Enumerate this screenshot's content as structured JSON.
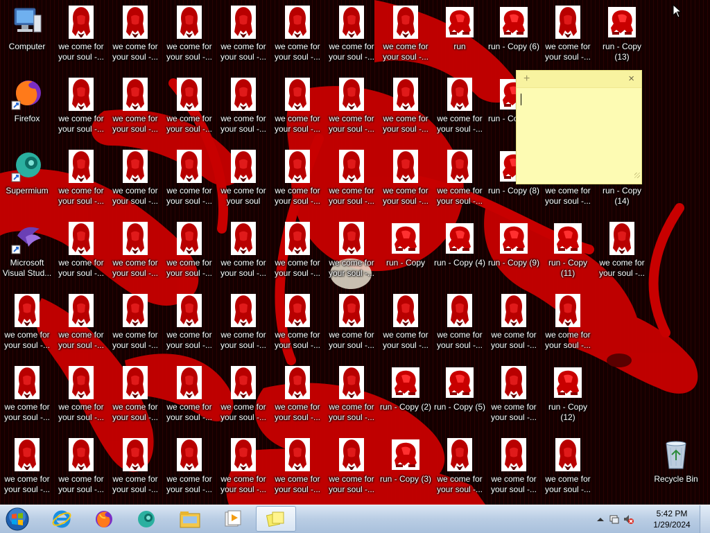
{
  "desktop": {
    "icons": [
      {
        "label": "Computer",
        "type": "computer",
        "col": 0,
        "row": 0
      },
      {
        "label": "Firefox",
        "type": "firefox",
        "col": 0,
        "row": 1
      },
      {
        "label": "Supermium",
        "type": "supermium",
        "col": 0,
        "row": 2
      },
      {
        "label": "Microsoft Visual Stud...",
        "type": "vs",
        "col": 0,
        "row": 3
      },
      {
        "label": "we come for your soul -...",
        "type": "soul",
        "col": 0,
        "row": 4
      },
      {
        "label": "we come for your soul -...",
        "type": "soul",
        "col": 0,
        "row": 5
      },
      {
        "label": "we come for your soul -...",
        "type": "soul",
        "col": 0,
        "row": 6
      },
      {
        "label": "we come for your soul -...",
        "type": "soul",
        "col": 1,
        "row": 0
      },
      {
        "label": "we come for your soul -...",
        "type": "soul",
        "col": 1,
        "row": 1
      },
      {
        "label": "we come for your soul -...",
        "type": "soul",
        "col": 1,
        "row": 2
      },
      {
        "label": "we come for your soul -...",
        "type": "soul",
        "col": 1,
        "row": 3
      },
      {
        "label": "we come for your soul -...",
        "type": "soul",
        "col": 1,
        "row": 4
      },
      {
        "label": "we come for your soul -...",
        "type": "soul",
        "col": 1,
        "row": 5
      },
      {
        "label": "we come for your soul -...",
        "type": "soul",
        "col": 1,
        "row": 6
      },
      {
        "label": "we come for your soul -...",
        "type": "soul",
        "col": 2,
        "row": 0
      },
      {
        "label": "we come for your soul -...",
        "type": "soul",
        "col": 2,
        "row": 1
      },
      {
        "label": "we come for your soul -...",
        "type": "soul",
        "col": 2,
        "row": 2
      },
      {
        "label": "we come for your soul -...",
        "type": "soul",
        "col": 2,
        "row": 3
      },
      {
        "label": "we come for your soul -...",
        "type": "soul",
        "col": 2,
        "row": 4
      },
      {
        "label": "we come for your soul -...",
        "type": "soul",
        "col": 2,
        "row": 5
      },
      {
        "label": "we come for your soul -...",
        "type": "soul",
        "col": 2,
        "row": 6
      },
      {
        "label": "we come for your soul -...",
        "type": "soul",
        "col": 3,
        "row": 0
      },
      {
        "label": "we come for your soul -...",
        "type": "soul",
        "col": 3,
        "row": 1
      },
      {
        "label": "we come for your soul -...",
        "type": "soul",
        "col": 3,
        "row": 2
      },
      {
        "label": "we come for your soul -...",
        "type": "soul",
        "col": 3,
        "row": 3
      },
      {
        "label": "we come for your soul -...",
        "type": "soul",
        "col": 3,
        "row": 4
      },
      {
        "label": "we come for your soul -...",
        "type": "soul",
        "col": 3,
        "row": 5
      },
      {
        "label": "we come for your soul -...",
        "type": "soul",
        "col": 3,
        "row": 6
      },
      {
        "label": "we come for your soul -...",
        "type": "soul",
        "col": 4,
        "row": 0
      },
      {
        "label": "we come for your soul -...",
        "type": "soul",
        "col": 4,
        "row": 1
      },
      {
        "label": "we come for your soul",
        "type": "soul",
        "col": 4,
        "row": 2
      },
      {
        "label": "we come for your soul -...",
        "type": "soul",
        "col": 4,
        "row": 3
      },
      {
        "label": "we come for your soul -...",
        "type": "soul",
        "col": 4,
        "row": 4
      },
      {
        "label": "we come for your soul -...",
        "type": "soul",
        "col": 4,
        "row": 5
      },
      {
        "label": "we come for your soul -...",
        "type": "soul",
        "col": 4,
        "row": 6
      },
      {
        "label": "we come for your soul -...",
        "type": "soul",
        "col": 5,
        "row": 0
      },
      {
        "label": "we come for your soul -...",
        "type": "soul",
        "col": 5,
        "row": 1
      },
      {
        "label": "we come for your soul -...",
        "type": "soul",
        "col": 5,
        "row": 2
      },
      {
        "label": "we come for your soul -...",
        "type": "soul",
        "col": 5,
        "row": 3
      },
      {
        "label": "we come for your soul -...",
        "type": "soul",
        "col": 5,
        "row": 4
      },
      {
        "label": "we come for your soul -...",
        "type": "soul",
        "col": 5,
        "row": 5
      },
      {
        "label": "we come for your soul -...",
        "type": "soul",
        "col": 5,
        "row": 6
      },
      {
        "label": "we come for your soul -...",
        "type": "soul",
        "col": 6,
        "row": 0
      },
      {
        "label": "we come for your soul -...",
        "type": "soul",
        "col": 6,
        "row": 1
      },
      {
        "label": "we come for your soul -...",
        "type": "soul",
        "col": 6,
        "row": 2
      },
      {
        "label": "we come for your soul -...",
        "type": "soul",
        "col": 6,
        "row": 3
      },
      {
        "label": "we come for your soul -...",
        "type": "soul",
        "col": 6,
        "row": 4
      },
      {
        "label": "we come for your soul -...",
        "type": "soul",
        "col": 6,
        "row": 5
      },
      {
        "label": "we come for your soul -...",
        "type": "soul",
        "col": 6,
        "row": 6
      },
      {
        "label": "we come for your soul -...",
        "type": "soul",
        "col": 7,
        "row": 0
      },
      {
        "label": "we come for your soul -...",
        "type": "soul",
        "col": 7,
        "row": 1
      },
      {
        "label": "we come for your soul -...",
        "type": "soul",
        "col": 7,
        "row": 2
      },
      {
        "label": "run - Copy",
        "type": "run",
        "col": 7,
        "row": 3
      },
      {
        "label": "we come for your soul -...",
        "type": "soul",
        "col": 7,
        "row": 4
      },
      {
        "label": "run - Copy (2)",
        "type": "run",
        "col": 7,
        "row": 5
      },
      {
        "label": "run - Copy (3)",
        "type": "run",
        "col": 7,
        "row": 6
      },
      {
        "label": "run",
        "type": "run",
        "col": 8,
        "row": 0
      },
      {
        "label": "we come for your soul -...",
        "type": "soul",
        "col": 8,
        "row": 1
      },
      {
        "label": "we come for your soul -...",
        "type": "soul",
        "col": 8,
        "row": 2
      },
      {
        "label": "run - Copy (4)",
        "type": "run",
        "col": 8,
        "row": 3
      },
      {
        "label": "we come for your soul -...",
        "type": "soul",
        "col": 8,
        "row": 4
      },
      {
        "label": "run - Copy (5)",
        "type": "run",
        "col": 8,
        "row": 5
      },
      {
        "label": "we come for your soul -...",
        "type": "soul",
        "col": 8,
        "row": 6
      },
      {
        "label": "run - Copy (6)",
        "type": "run",
        "col": 9,
        "row": 0
      },
      {
        "label": "run - Copy (7)",
        "type": "run",
        "col": 9,
        "row": 1
      },
      {
        "label": "run - Copy (8)",
        "type": "run",
        "col": 9,
        "row": 2
      },
      {
        "label": "run - Copy (9)",
        "type": "run",
        "col": 9,
        "row": 3
      },
      {
        "label": "we come for your soul -...",
        "type": "soul",
        "col": 9,
        "row": 4
      },
      {
        "label": "we come for your soul -...",
        "type": "soul",
        "col": 9,
        "row": 5
      },
      {
        "label": "we come for your soul -...",
        "type": "soul",
        "col": 9,
        "row": 6
      },
      {
        "label": "we come for your soul -...",
        "type": "soul",
        "col": 10,
        "row": 0
      },
      {
        "label": "we come for your soul -...",
        "type": "soul",
        "col": 10,
        "row": 2
      },
      {
        "label": "run - Copy (11)",
        "type": "run",
        "col": 10,
        "row": 3
      },
      {
        "label": "we come for your soul -...",
        "type": "soul",
        "col": 10,
        "row": 4
      },
      {
        "label": "run - Copy (12)",
        "type": "run",
        "col": 10,
        "row": 5
      },
      {
        "label": "we come for your soul -...",
        "type": "soul",
        "col": 10,
        "row": 6
      },
      {
        "label": "run - Copy (13)",
        "type": "run",
        "col": 11,
        "row": 0
      },
      {
        "label": "run - Copy (14)",
        "type": "run",
        "col": 11,
        "row": 2
      },
      {
        "label": "we come for your soul -...",
        "type": "soul",
        "col": 11,
        "row": 3
      },
      {
        "label": "Recycle Bin",
        "type": "recycle",
        "col": 12,
        "row": 6
      }
    ]
  },
  "sticky_note": {
    "add_symbol": "+",
    "close_symbol": "×",
    "text": ""
  },
  "taskbar": {
    "pinned": [
      {
        "name": "start",
        "icon": "windows-orb-icon"
      },
      {
        "name": "internet-explorer",
        "icon": "internet-explorer-icon"
      },
      {
        "name": "firefox",
        "icon": "firefox-icon"
      },
      {
        "name": "supermium",
        "icon": "supermium-icon"
      },
      {
        "name": "windows-explorer",
        "icon": "folder-icon"
      },
      {
        "name": "media-player",
        "icon": "media-player-icon"
      },
      {
        "name": "sticky-notes",
        "icon": "sticky-notes-icon",
        "active": true
      }
    ],
    "clock": {
      "time": "5:42 PM",
      "date": "1/29/2024"
    }
  },
  "colors": {
    "wallpaper_red": "#d10000",
    "wallpaper_dark": "#1a0000",
    "sticky_bg": "#fdfbb3",
    "taskbar_top": "#dae6f3"
  }
}
